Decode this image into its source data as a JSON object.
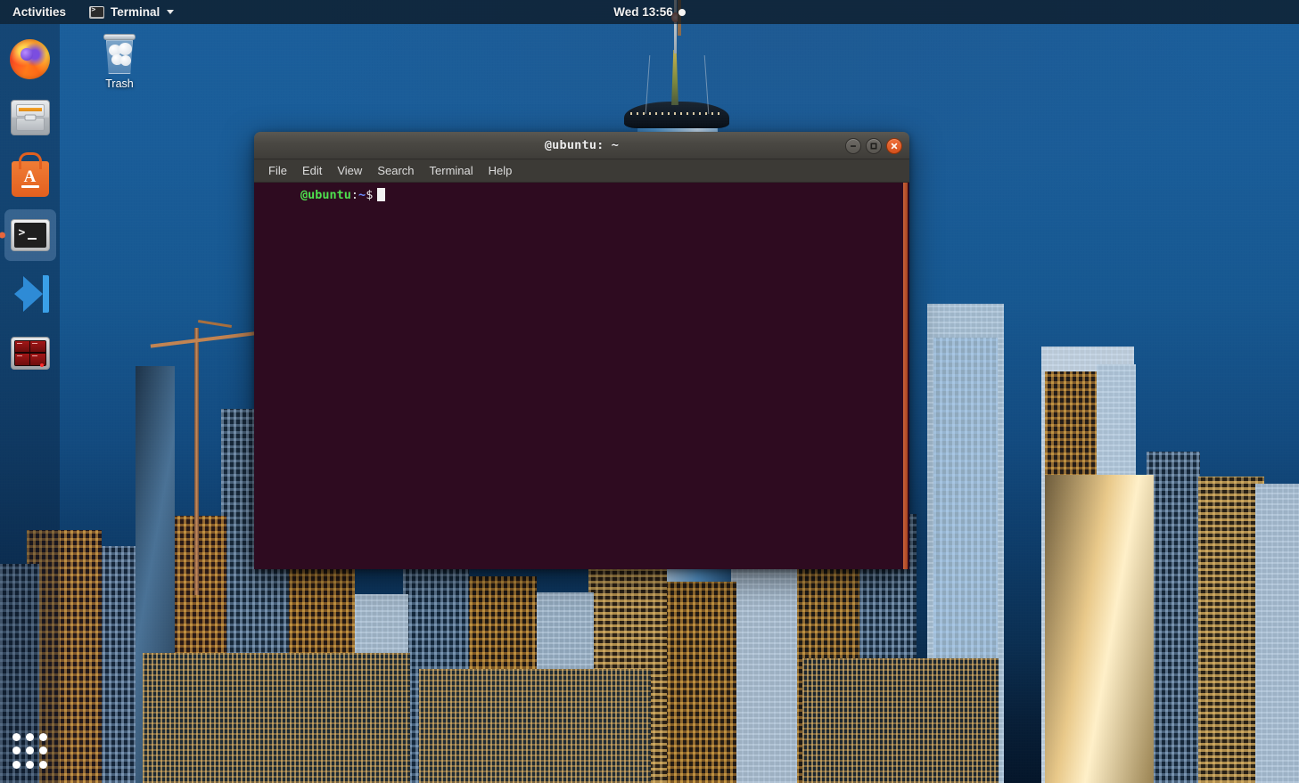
{
  "top_bar": {
    "activities_label": "Activities",
    "app_name": "Terminal",
    "app_icon": "terminal-icon",
    "clock": "Wed 13:56",
    "notification_indicator": "●"
  },
  "dock": {
    "items": [
      {
        "name": "firefox",
        "label": "Firefox Web Browser",
        "active": false
      },
      {
        "name": "files",
        "label": "Files",
        "active": false
      },
      {
        "name": "ubuntu-software",
        "label": "Ubuntu Software",
        "active": false,
        "glyph": "A"
      },
      {
        "name": "terminal",
        "label": "Terminal",
        "active": true
      },
      {
        "name": "vscode",
        "label": "Visual Studio Code",
        "active": false
      },
      {
        "name": "terminator",
        "label": "Terminator",
        "active": false
      }
    ],
    "show_applications_label": "Show Applications"
  },
  "desktop": {
    "icons": [
      {
        "name": "trash",
        "label": "Trash"
      }
    ]
  },
  "terminal_window": {
    "title": "@ubuntu: ~",
    "menu": [
      "File",
      "Edit",
      "View",
      "Search",
      "Terminal",
      "Help"
    ],
    "controls": {
      "minimize": "minimize",
      "maximize": "maximize",
      "close": "close"
    },
    "prompt": {
      "user_host": "@ubuntu",
      "separator": ":",
      "path": "~",
      "sigil": "$",
      "command": ""
    },
    "colors": {
      "background": "#2e0b20",
      "titlebar": "#4a4843",
      "menubar": "#3c3a36",
      "prompt_user": "#4ee24e",
      "prompt_path": "#6d8cff",
      "scrollbar": "#b5502a",
      "close_button": "#e05a1c"
    }
  }
}
